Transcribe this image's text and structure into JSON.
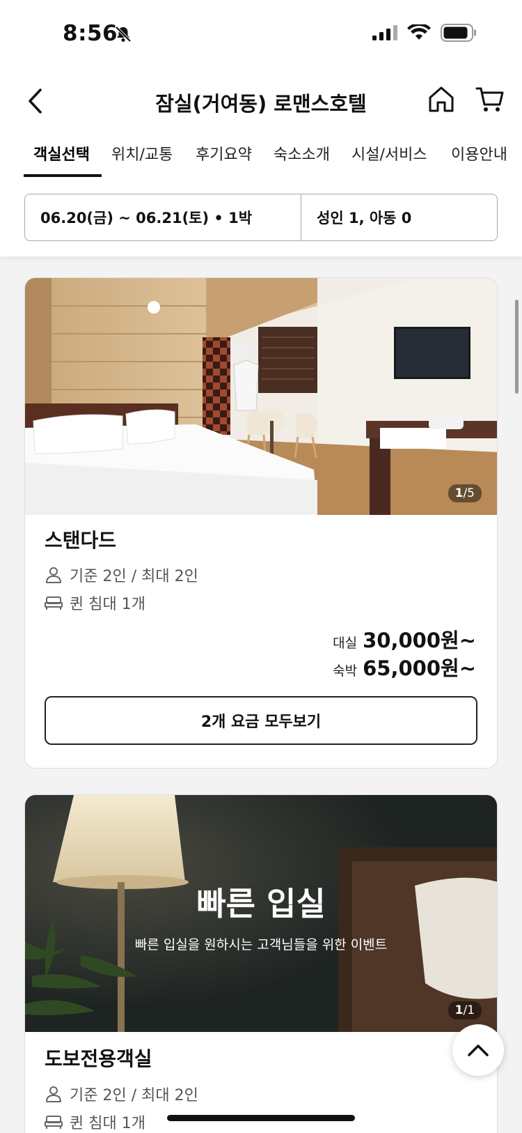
{
  "status": {
    "time": "8:56"
  },
  "header": {
    "title": "잠실(거여동) 로맨스호텔"
  },
  "tabs": [
    {
      "label": "객실선택"
    },
    {
      "label": "위치/교통"
    },
    {
      "label": "후기요약"
    },
    {
      "label": "숙소소개"
    },
    {
      "label": "시설/서비스"
    },
    {
      "label": "이용안내"
    }
  ],
  "filter": {
    "dates": "06.20(금) ~ 06.21(토) • 1박",
    "guests": "성인 1, 아동 0"
  },
  "rooms": [
    {
      "image_counter_current": "1",
      "image_counter_total": "/5",
      "name": "스탠다드",
      "capacity": "기준 2인 / 최대 2인",
      "bed": "퀸 침대 1개",
      "rental_label": "대실",
      "rental_price": "30,000원~",
      "stay_label": "숙박",
      "stay_price": "65,000원~",
      "rates_button": "2개 요금 모두보기"
    },
    {
      "image_counter_current": "1",
      "image_counter_total": "/1",
      "event_title": "빠른 입실",
      "event_subtitle": "빠른 입실을 원하시는 고객님들을 위한 이벤트",
      "name": "도보전용객실",
      "capacity": "기준 2인 / 최대 2인",
      "bed": "퀸 침대 1개"
    }
  ],
  "colors": {
    "accent": "#111111",
    "background": "#f3f3f3"
  }
}
